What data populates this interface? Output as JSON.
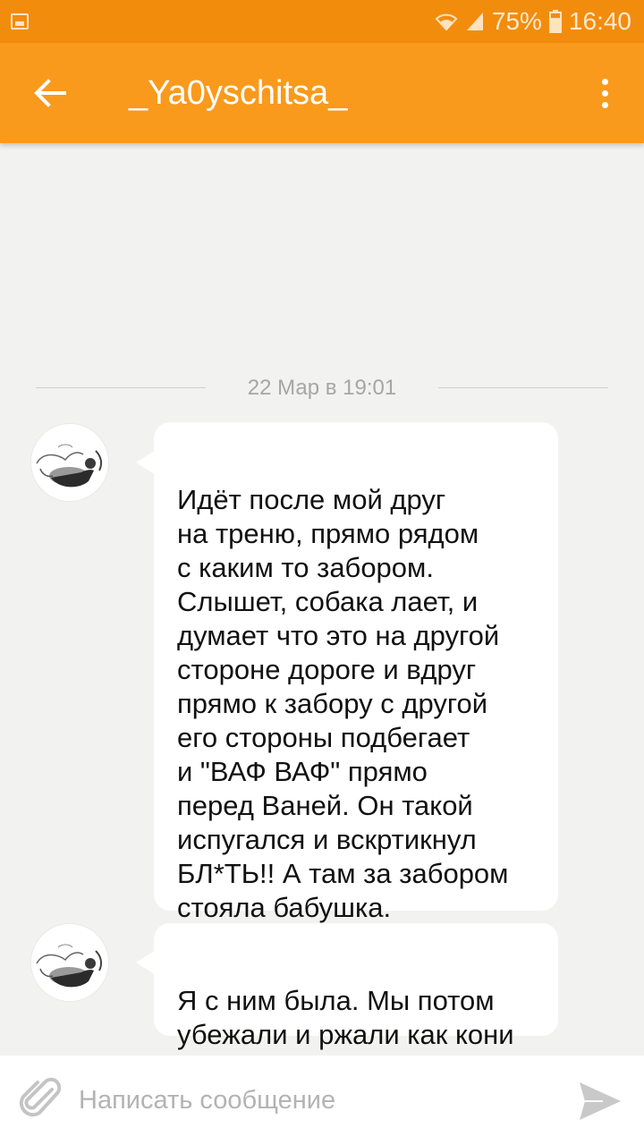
{
  "status_bar": {
    "battery": "75%",
    "time": "16:40",
    "icons": [
      "gallery-notification-icon",
      "wifi-icon",
      "signal-icon",
      "battery-icon"
    ]
  },
  "header": {
    "title": "_Ya0yschitsa_",
    "back_icon": "arrow-left-icon",
    "more_icon": "more-vert-icon"
  },
  "chat": {
    "date_separator": "22 Мар в 19:01",
    "messages": [
      {
        "text": "Идёт после мой друг\nна треню, прямо рядом\nс каким то забором.\nСлышет, собака лает, и\nдумает что это на другой\nстороне дороге и вдруг\nпрямо к забору с другой\nего стороны подбегает\nи \"ВАФ ВАФ\" прямо\nперед Ваней. Он такой\nиспугался и вскртикнул\nБЛ*ТЬ!! А там за забором\nстояла бабушка."
      },
      {
        "text": "Я с ним была. Мы потом\nубежали и ржали как кони"
      }
    ]
  },
  "composer": {
    "placeholder": "Написать сообщение",
    "value": "",
    "attach_icon": "paperclip-icon",
    "send_icon": "send-icon"
  },
  "colors": {
    "status_bar": "#f28c0d",
    "app_bar": "#f99a1c",
    "background": "#f2f2f0",
    "bubble": "#ffffff"
  }
}
